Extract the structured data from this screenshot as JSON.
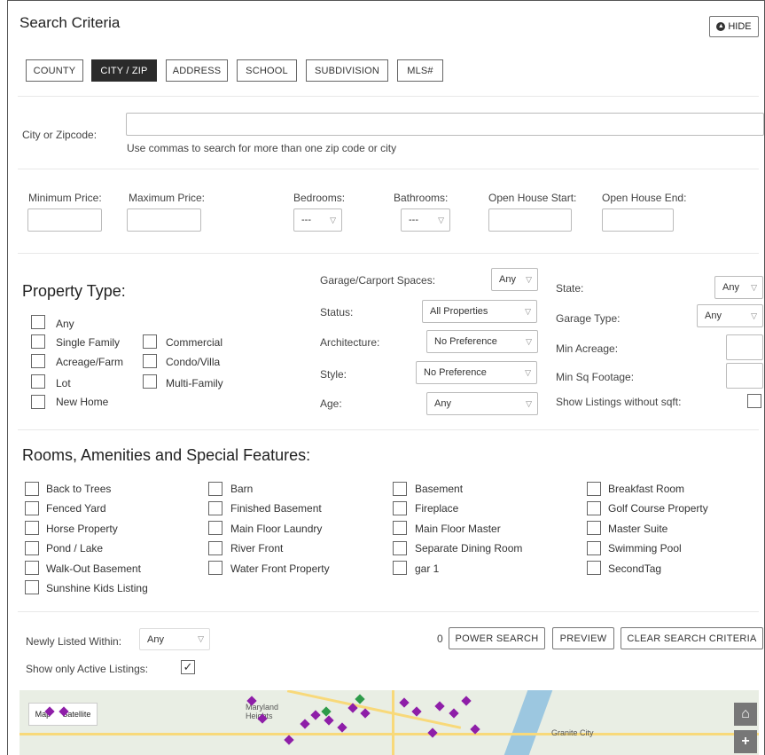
{
  "header": {
    "title": "Search Criteria",
    "hide_label": "HIDE"
  },
  "tabs": [
    {
      "label": "COUNTY"
    },
    {
      "label": "CITY / ZIP"
    },
    {
      "label": "ADDRESS"
    },
    {
      "label": "SCHOOL"
    },
    {
      "label": "SUBDIVISION"
    },
    {
      "label": "MLS#"
    }
  ],
  "location": {
    "label": "City or Zipcode:",
    "value": "",
    "help": "Use commas to search for more than one zip code or city"
  },
  "price_row": {
    "min_price_label": "Minimum Price:",
    "max_price_label": "Maximum Price:",
    "bedrooms_label": "Bedrooms:",
    "bedrooms_value": "---",
    "bathrooms_label": "Bathrooms:",
    "bathrooms_value": "---",
    "open_start_label": "Open House Start:",
    "open_end_label": "Open House End:"
  },
  "property_type": {
    "title": "Property Type:",
    "col1": [
      "Any",
      "Single Family",
      "Acreage/Farm",
      "Lot",
      "New Home"
    ],
    "col2": [
      "Commercial",
      "Condo/Villa",
      "Multi-Family"
    ]
  },
  "filters_mid": {
    "garage_label": "Garage/Carport Spaces:",
    "garage_value": "Any",
    "status_label": "Status:",
    "status_value": "All Properties",
    "architecture_label": "Architecture:",
    "architecture_value": "No Preference",
    "style_label": "Style:",
    "style_value": "No Preference",
    "age_label": "Age:",
    "age_value": "Any"
  },
  "filters_right": {
    "state_label": "State:",
    "state_value": "Any",
    "garage_type_label": "Garage Type:",
    "garage_type_value": "Any",
    "min_acreage_label": "Min Acreage:",
    "min_sqft_label": "Min Sq Footage:",
    "no_sqft_label": "Show Listings without sqft:"
  },
  "amenities": {
    "title": "Rooms, Amenities and Special Features:",
    "col1": [
      "Back to Trees",
      "Fenced Yard",
      "Horse Property",
      "Pond / Lake",
      "Walk-Out Basement",
      "Sunshine Kids Listing"
    ],
    "col2": [
      "Barn",
      "Finished Basement",
      "Main Floor Laundry",
      "River Front",
      "Water Front Property"
    ],
    "col3": [
      "Basement",
      "Fireplace",
      "Main Floor Master",
      "Separate Dining Room",
      "gar 1"
    ],
    "col4": [
      "Breakfast Room",
      "Golf Course Property",
      "Master Suite",
      "Swimming Pool",
      "SecondTag"
    ]
  },
  "bottom": {
    "newly_listed_label": "Newly Listed Within:",
    "newly_listed_value": "Any",
    "active_only_label": "Show only Active Listings:",
    "active_only_checked": true,
    "count": "0",
    "power_search": "POWER SEARCH",
    "preview": "PREVIEW",
    "clear": "CLEAR SEARCH CRITERIA"
  },
  "map": {
    "map_btn": "Map",
    "satellite_btn": "Satellite",
    "place_1": "Maryland Heights",
    "place_2": "Granite City"
  }
}
